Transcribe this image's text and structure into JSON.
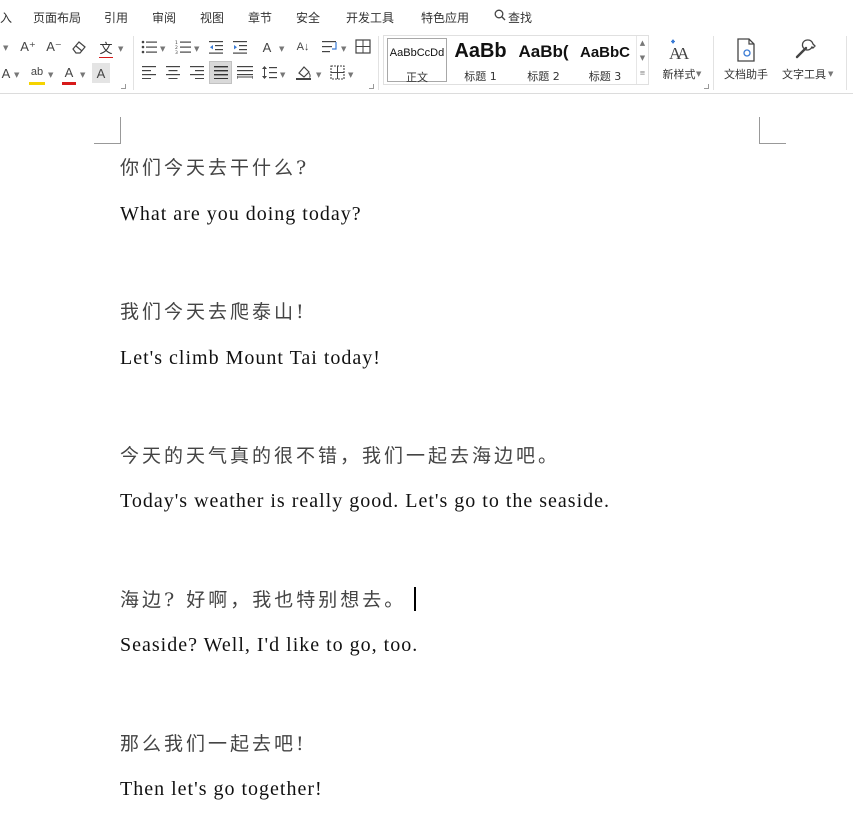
{
  "menu": {
    "tabs": [
      "入",
      "页面布局",
      "引用",
      "审阅",
      "视图",
      "章节",
      "安全",
      "开发工具",
      "特色应用"
    ],
    "search_label": "查找"
  },
  "ribbon": {
    "font": {
      "grow": "A⁺",
      "shrink": "A⁻",
      "clear": "⌫",
      "pinyin": "文",
      "text_effect": "A",
      "highlight": "ab",
      "font_color": "A",
      "char_shade": "A",
      "highlight_color": "#f5d300",
      "font_color_swatch": "#d71a1a"
    },
    "paragraph": {
      "sort": "A↓",
      "text_direction": "A"
    },
    "styles": [
      {
        "sample": "AaBbCcDd",
        "label": "正文"
      },
      {
        "sample": "AaBb",
        "label": "标题 1"
      },
      {
        "sample": "AaBb(",
        "label": "标题 2"
      },
      {
        "sample": "AaBbC",
        "label": "标题 3"
      }
    ],
    "new_style": {
      "icon_text": "A",
      "label": "新样式"
    },
    "doc_assistant": {
      "label": "文档助手"
    },
    "text_tools": {
      "label": "文字工具"
    }
  },
  "document": {
    "lines": [
      {
        "lang": "zh",
        "text": "你们今天去干什么?"
      },
      {
        "lang": "en",
        "text": "What are you doing today?"
      },
      {
        "lang": "zh",
        "text": "我们今天去爬泰山!"
      },
      {
        "lang": "en",
        "text": "Let's climb Mount Tai today!"
      },
      {
        "lang": "zh",
        "text": "今天的天气真的很不错，我们一起去海边吧。"
      },
      {
        "lang": "en",
        "text": "Today's weather is really good. Let's go to the seaside."
      },
      {
        "lang": "zh",
        "text": "海边? 好啊，我也特别想去。"
      },
      {
        "lang": "en",
        "text": "Seaside? Well, I'd like to go, too."
      },
      {
        "lang": "zh",
        "text": "那么我们一起去吧!"
      },
      {
        "lang": "en",
        "text": "Then let's go together!"
      }
    ]
  }
}
